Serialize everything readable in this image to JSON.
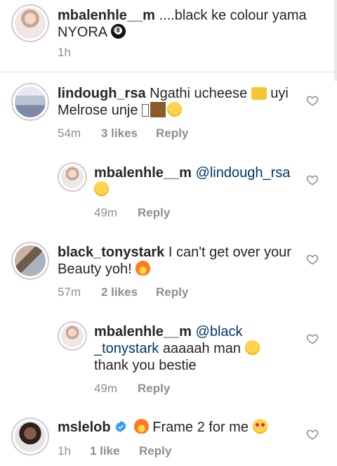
{
  "comments": [
    {
      "username": "mbalenhle__m",
      "text": " ....black ke colour yama NYORA",
      "time": "1h"
    },
    {
      "username": "lindough_rsa",
      "text": " Ngathi ucheese ",
      "text2": " uyi Melrose unje ",
      "time": "54m",
      "likes": "3 likes",
      "reply": "Reply"
    },
    {
      "username": "mbalenhle__m",
      "mention": "@lindough_rsa",
      "time": "49m",
      "reply": "Reply"
    },
    {
      "username": "black_tonystark",
      "text": " I can't get over your Beauty yoh! ",
      "time": "57m",
      "likes": "2 likes",
      "reply": "Reply"
    },
    {
      "username": "mbalenhle__m",
      "mention": "@black _tonystark",
      "text": " aaaaah man ",
      "text2": "thank you bestie",
      "time": "49m",
      "reply": "Reply"
    },
    {
      "username": "mslelob",
      "text": "Frame 2 for me ",
      "time": "1h",
      "likes": "1 like",
      "reply": "Reply"
    }
  ],
  "icons": {
    "eight_ball": "eight-ball-emoji",
    "cheese": "cheese-emoji",
    "laugh": "tears-of-joy-emoji",
    "rofl": "rolling-laughing-emoji",
    "fire": "fire-emoji",
    "smile": "smiling-emoji",
    "heart_eyes": "heart-eyes-emoji",
    "verified": "verified-badge-icon",
    "heart": "heart-outline-icon"
  },
  "colors": {
    "mention": "#00376b",
    "meta": "#8e8e8e",
    "verified": "#3897f0"
  }
}
